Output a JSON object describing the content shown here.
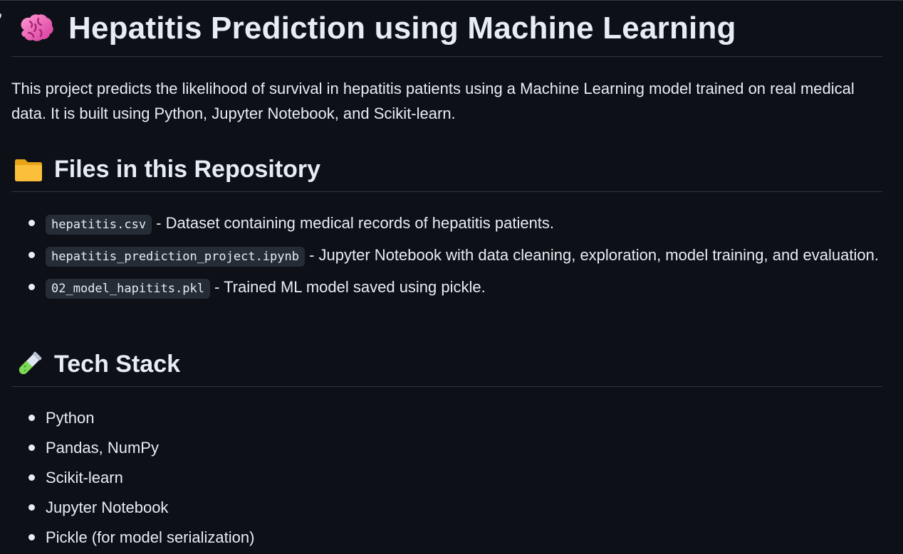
{
  "title": {
    "icon": "brain-icon",
    "text": "Hepatitis Prediction using Machine Learning"
  },
  "intro": "This project predicts the likelihood of survival in hepatitis patients using a Machine Learning model trained on real medical data. It is built using Python, Jupyter Notebook, and Scikit-learn.",
  "files_section": {
    "icon": "folder-icon",
    "heading": "Files in this Repository",
    "items": [
      {
        "code": "hepatitis.csv",
        "text": " - Dataset containing medical records of hepatitis patients."
      },
      {
        "code": "hepatitis_prediction_project.ipynb",
        "text": " - Jupyter Notebook with data cleaning, exploration, model training, and evaluation."
      },
      {
        "code": "02_model_hapitits.pkl",
        "text": " - Trained ML model saved using pickle."
      }
    ]
  },
  "tech_section": {
    "icon": "test-tube-icon",
    "heading": "Tech Stack",
    "items": [
      "Python",
      "Pandas, NumPy",
      "Scikit-learn",
      "Jupyter Notebook",
      "Pickle (for model serialization)"
    ]
  },
  "colors": {
    "background": "#0d1117",
    "text": "#e6edf3",
    "divider": "#30363d",
    "code_background": "#262c36"
  }
}
